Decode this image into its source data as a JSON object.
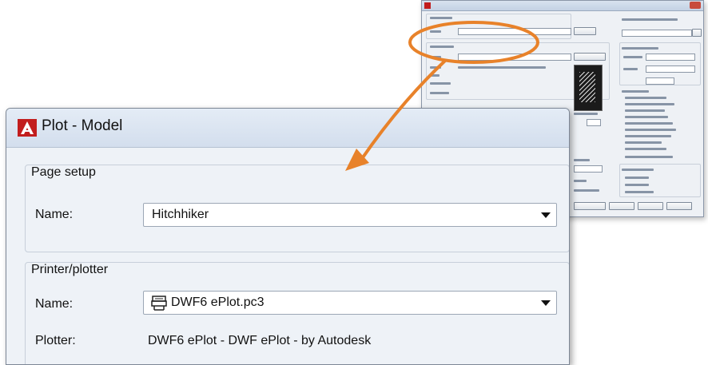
{
  "window": {
    "title": "Plot - Model"
  },
  "page_setup": {
    "group_label": "Page setup",
    "name_label": "Name:",
    "name_value": "Hitchhiker"
  },
  "printer_plotter": {
    "group_label": "Printer/plotter",
    "name_label": "Name:",
    "name_value": "DWF6 ePlot.pc3",
    "plotter_label": "Plotter:",
    "plotter_value": "DWF6 ePlot - DWF ePlot - by Autodesk"
  },
  "icons": {
    "app": "autocad-logo-icon",
    "printer": "plotter-icon",
    "dropdown": "chevron-down-icon"
  },
  "colors": {
    "callout": "#e8822a",
    "logo": "#c21d1d"
  }
}
